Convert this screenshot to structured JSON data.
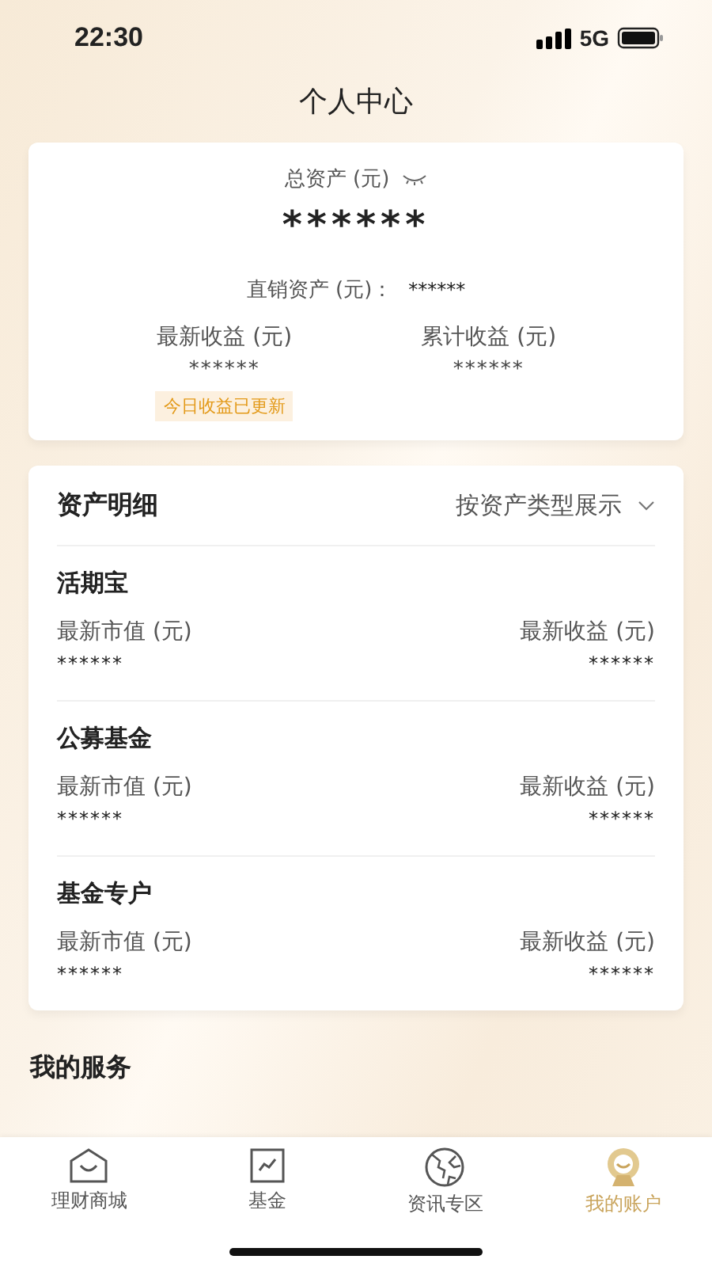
{
  "status_bar": {
    "time": "22:30",
    "network": "5G"
  },
  "header": {
    "title": "个人中心"
  },
  "summary": {
    "total_label": "总资产 (元)",
    "total_value": "******",
    "hidden": true,
    "direct_label": "直销资产 (元)：",
    "direct_value": "******",
    "stats": [
      {
        "label": "最新收益 (元)",
        "value": "******",
        "badge": "今日收益已更新"
      },
      {
        "label": "累计收益 (元)",
        "value": "******"
      }
    ]
  },
  "details": {
    "title": "资产明细",
    "filter": "按资产类型展示",
    "groups": [
      {
        "name": "活期宝",
        "left_label": "最新市值 (元)",
        "left_value": "******",
        "right_label": "最新收益 (元)",
        "right_value": "******"
      },
      {
        "name": "公募基金",
        "left_label": "最新市值 (元)",
        "left_value": "******",
        "right_label": "最新收益 (元)",
        "right_value": "******"
      },
      {
        "name": "基金专户",
        "left_label": "最新市值 (元)",
        "left_value": "******",
        "right_label": "最新收益 (元)",
        "right_value": "******"
      }
    ]
  },
  "services": {
    "title": "我的服务"
  },
  "tab_bar": [
    {
      "kind": "home",
      "label": "理财商城",
      "selected": false
    },
    {
      "kind": "chart",
      "label": "基金",
      "selected": false
    },
    {
      "kind": "globe",
      "label": "资讯专区",
      "selected": false
    },
    {
      "kind": "account",
      "label": "我的账户",
      "selected": true
    }
  ]
}
